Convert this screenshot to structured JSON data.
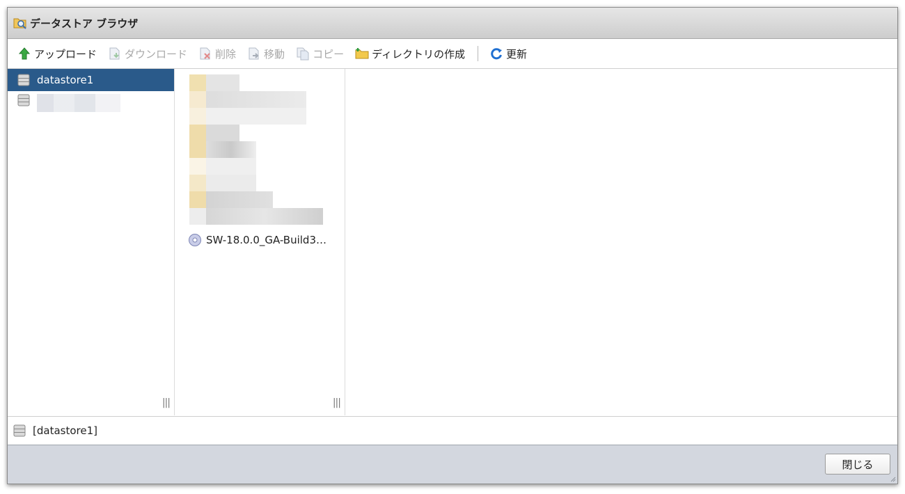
{
  "window": {
    "title": "データストア ブラウザ"
  },
  "toolbar": {
    "items": [
      {
        "label": "アップロード",
        "icon": "up-arrow-icon",
        "enabled": true
      },
      {
        "label": "ダウンロード",
        "icon": "download-icon",
        "enabled": false
      },
      {
        "label": "削除",
        "icon": "delete-icon",
        "enabled": false
      },
      {
        "label": "移動",
        "icon": "move-icon",
        "enabled": false
      },
      {
        "label": "コピー",
        "icon": "copy-icon",
        "enabled": false
      },
      {
        "label": "ディレクトリの作成",
        "icon": "new-folder-icon",
        "enabled": true
      },
      {
        "label": "更新",
        "icon": "refresh-icon",
        "enabled": true
      }
    ]
  },
  "datastores": [
    {
      "label": "datastore1",
      "selected": true,
      "icon": "datastore-icon"
    },
    {
      "label": "",
      "selected": false,
      "icon": "datastore-icon",
      "blurred": true
    }
  ],
  "files": [
    {
      "label": "SW-18.0.0_GA-Build3…",
      "icon": "disc-icon"
    }
  ],
  "status": {
    "path": "[datastore1]"
  },
  "footer": {
    "close_label": "閉じる"
  },
  "colors": {
    "selection": "#2a5a8a",
    "footer": "#d3d7df",
    "titlebar": "#d9d9d9"
  }
}
